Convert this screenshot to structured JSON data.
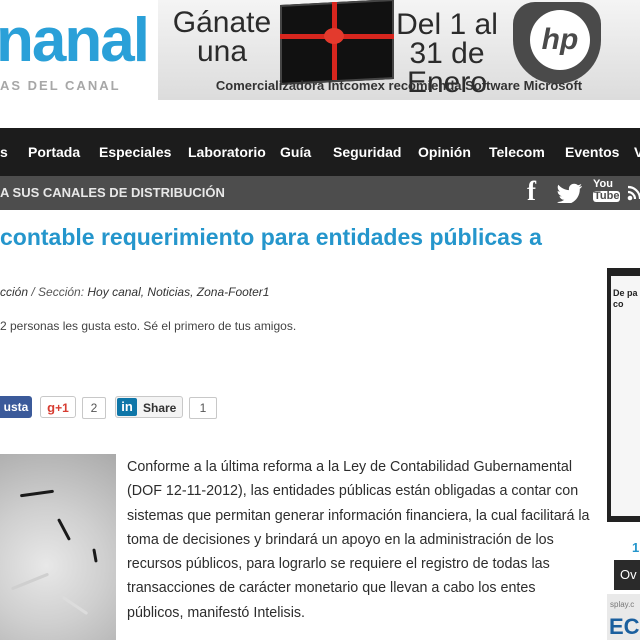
{
  "header": {
    "logo_text": "nanal",
    "logo_tagline": "AS DEL CANAL",
    "banner": {
      "left_text": "Gánate una",
      "right_text": "Del 1 al 31 de Enero",
      "brand_logo": "hp",
      "bottom_text": "Comercializadora Intcomex recomienda Software Microsoft"
    }
  },
  "nav": {
    "items": [
      "s",
      "Portada",
      "Especiales",
      "Laboratorio",
      "Guía",
      "Seguridad",
      "Opinión",
      "Telecom",
      "Eventos",
      "V"
    ]
  },
  "subnav": {
    "text": "A SUS CANALES DE DISTRIBUCIÓN",
    "social": {
      "facebook": "f",
      "twitter_icon": "twitter-bird-icon",
      "youtube_top": "You",
      "youtube_bottom": "Tube",
      "rss_icon": "rss-icon"
    }
  },
  "article": {
    "title": "contable requerimiento para entidades públicas a",
    "meta_prefix": "cción",
    "meta_section_label": " / Sección: ",
    "meta_sections": "Hoy canal, Noticias, Zona-Footer1",
    "likes_text": "2 personas les gusta esto. Sé el primero de tus amigos.",
    "share": {
      "facebook_label": "usta",
      "gplus_label": "+1",
      "gplus_count": "2",
      "linkedin_label": "Share",
      "linkedin_count": "1"
    },
    "body": "Conforme a la última reforma a la Ley de Contabilidad Gubernamental (DOF 12-11-2012), las entidades públicas están obligadas a contar con sistemas que permitan generar información financiera, la cual facilitará la toma de decisiones y brindará un apoyo en la administración de los recursos públicos, para lograrlo se requiere el registro de todas las transacciones de carácter monetario que llevan a cabo los entes públicos, manifestó Intelisis."
  },
  "sidebar": {
    "ad_text": "De pa co",
    "number": "1",
    "bar_text": "Ov",
    "bottom_small": "splay.c",
    "bottom_big": "EC"
  }
}
